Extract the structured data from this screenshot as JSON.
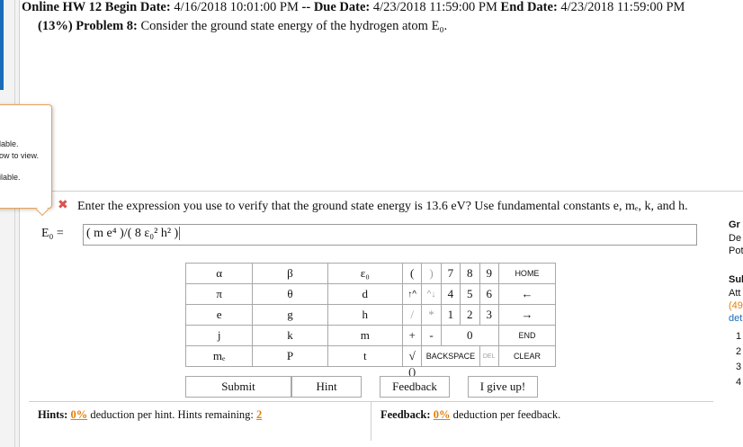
{
  "header": {
    "title": "Online HW 12",
    "begin_label": "Begin Date:",
    "begin_date": "4/16/2018 10:01:00 PM",
    "sep": "--",
    "due_label": "Due Date:",
    "due_date": "4/23/2018 11:59:00 PM",
    "end_label": "End Date:",
    "end_date": "4/23/2018 11:59:00 PM"
  },
  "problem": {
    "label": "(13%) Problem 8:",
    "text": "Consider the ground state energy of the hydrogen atom E₀."
  },
  "popup": {
    "lines": [
      "lable.",
      "ow to view.",
      "ilable."
    ]
  },
  "question": {
    "text": "Enter the expression you use to verify that the ground state energy is 13.6 eV? Use fundamental constants e, mₑ, k, and h."
  },
  "side_panel": {
    "lines": [
      "Gr",
      "De",
      "Pot",
      "Sul",
      "Att",
      "(49",
      "det",
      "1",
      "2",
      "3",
      "4"
    ]
  },
  "answer": {
    "label": "E₀ =",
    "value": "( m e⁴ )/( 8 ε₀² h² )"
  },
  "keypad": {
    "greek": [
      "α",
      "π",
      "e",
      "j",
      "mₑ"
    ],
    "col2": [
      "β",
      "θ",
      "g",
      "k",
      "P"
    ],
    "col3": [
      "ε₀",
      "d",
      "h",
      "m",
      "t"
    ],
    "ops": [
      "(",
      ")",
      "↑^",
      "^↓",
      "/",
      "*",
      "+",
      "-",
      "√",
      "()"
    ],
    "digits": [
      "7",
      "8",
      "9",
      "4",
      "5",
      "6",
      "1",
      "2",
      "3",
      "0"
    ],
    "keys": [
      "HOME",
      "←",
      "→",
      "END",
      "BACKSPACE",
      "DEL",
      "CLEAR"
    ]
  },
  "buttons": {
    "submit": "Submit",
    "hint": "Hint",
    "feedback": "Feedback",
    "give_up": "I give up!"
  },
  "hints": {
    "label": "Hints:",
    "deduction": "0%",
    "suffix": "deduction per hint. Hints remaining:",
    "remaining": "2"
  },
  "feedback": {
    "label": "Feedback:",
    "deduction": "0%",
    "suffix": "deduction per feedback."
  },
  "colors": {
    "accent_orange": "#e87e04",
    "icon_red": "#d9534f",
    "left_blue": "#1b6bb8"
  }
}
